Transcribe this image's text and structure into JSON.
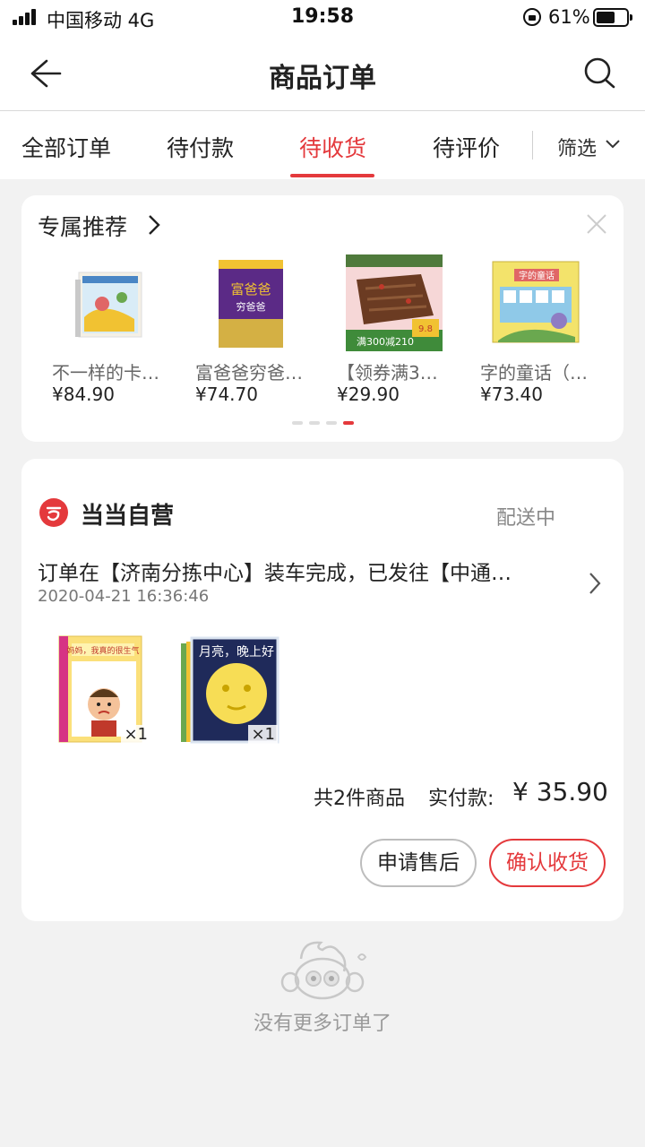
{
  "status_bar": {
    "carrier": "中国移动  4G",
    "time": "19:58",
    "battery": "61%",
    "battery_level": 0.61
  },
  "nav": {
    "title": "商品订单",
    "back_icon": "back-arrow-icon",
    "search_icon": "search-icon"
  },
  "tabs": {
    "items": [
      {
        "label": "全部订单",
        "active": false
      },
      {
        "label": "待付款",
        "active": false
      },
      {
        "label": "待收货",
        "active": true
      },
      {
        "label": "待评价",
        "active": false
      }
    ],
    "filter_label": "筛选"
  },
  "recommend": {
    "title": "专属推荐",
    "items": [
      {
        "name": "不一样的卡…",
        "price": "¥84.90",
        "icon": "book-cover"
      },
      {
        "name": "富爸爸穷爸…",
        "price": "¥74.70",
        "icon": "book-cover"
      },
      {
        "name": "【领券满3…",
        "price": "¥29.90",
        "icon": "snack-package"
      },
      {
        "name": "字的童话（…",
        "price": "¥73.40",
        "icon": "book-box"
      }
    ],
    "page_count": 4,
    "active_page": 4
  },
  "order": {
    "shop_name": "当当自营",
    "status": "配送中",
    "logistics_text": "订单在【济南分拣中心】装车完成，已发往【中通…",
    "logistics_time": "2020-04-21 16:36:46",
    "products": [
      {
        "qty": "×1",
        "icon": "picture-book"
      },
      {
        "qty": "×1",
        "icon": "picture-book"
      }
    ],
    "count_text": "共2件商品",
    "paid_label": "实付款:",
    "amount": "¥ 35.90",
    "buttons": {
      "after_sale": "申请售后",
      "confirm": "确认收货"
    }
  },
  "empty": {
    "text": "没有更多订单了"
  },
  "colors": {
    "accent": "#e4393c",
    "background": "#f2f2f2"
  }
}
